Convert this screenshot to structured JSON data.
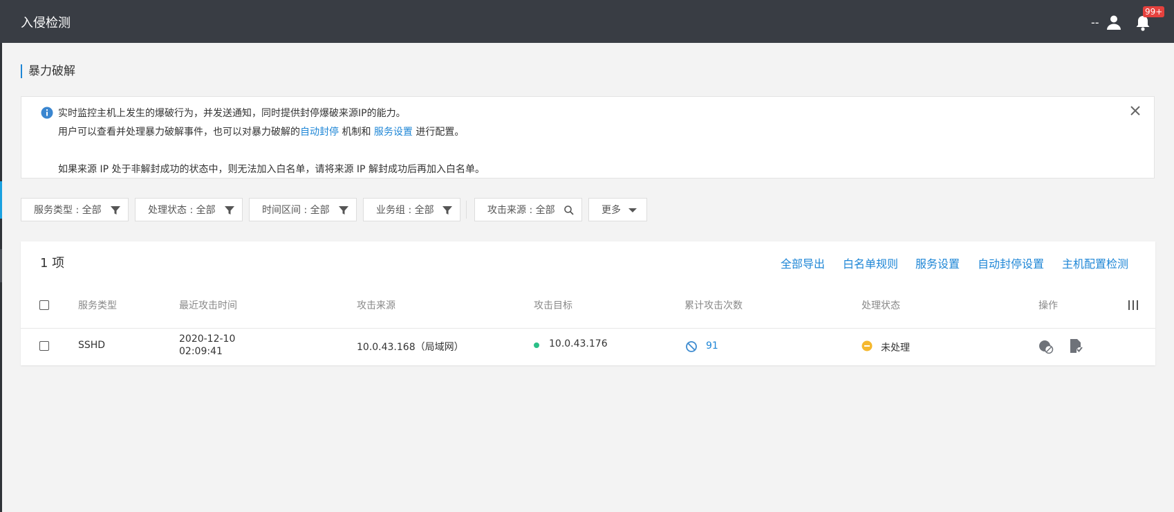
{
  "app": {
    "title": "入侵检测",
    "user_text": "--",
    "notification_badge": "99+"
  },
  "section": {
    "title": "暴力破解"
  },
  "notice": {
    "line1": "实时监控主机上发生的爆破行为，并发送通知，同时提供封停爆破来源IP的能力。",
    "line2_prefix": "用户可以查看并处理暴力破解事件，也可以对暴力破解的",
    "link_auto_block": "自动封停",
    "line2_mid": " 机制和 ",
    "link_service_settings": "服务设置",
    "line2_suffix": " 进行配置。",
    "line3": "如果来源 IP 处于非解封成功的状态中，则无法加入白名单，请将来源 IP 解封成功后再加入白名单。"
  },
  "filters": [
    {
      "label": "服务类型 : 全部",
      "icon": "filter-icon"
    },
    {
      "label": "处理状态 : 全部",
      "icon": "filter-icon"
    },
    {
      "label": "时间区间 : 全部",
      "icon": "filter-icon"
    },
    {
      "label": "业务组 : 全部",
      "icon": "filter-icon"
    },
    {
      "label": "攻击来源 : 全部",
      "icon": "search-icon"
    },
    {
      "label": "更多",
      "icon": "caret-down-icon"
    }
  ],
  "table": {
    "count_label": "1 项",
    "actions": [
      "全部导出",
      "白名单规则",
      "服务设置",
      "自动封停设置",
      "主机配置检测"
    ],
    "columns": [
      "服务类型",
      "最近攻击时间",
      "攻击来源",
      "攻击目标",
      "累计攻击次数",
      "处理状态",
      "操作"
    ],
    "rows": [
      {
        "service_type": "SSHD",
        "last_attack_date": "2020-12-10",
        "last_attack_time": "02:09:41",
        "source": "10.0.43.168（局域网）",
        "target": "10.0.43.176",
        "attack_count": "91",
        "status": "未处理"
      }
    ]
  },
  "colors": {
    "topbar": "#393d44",
    "accent": "#1e86d6",
    "status_pending": "#f5b82e",
    "online": "#2bbf87",
    "badge": "#e5413d"
  }
}
